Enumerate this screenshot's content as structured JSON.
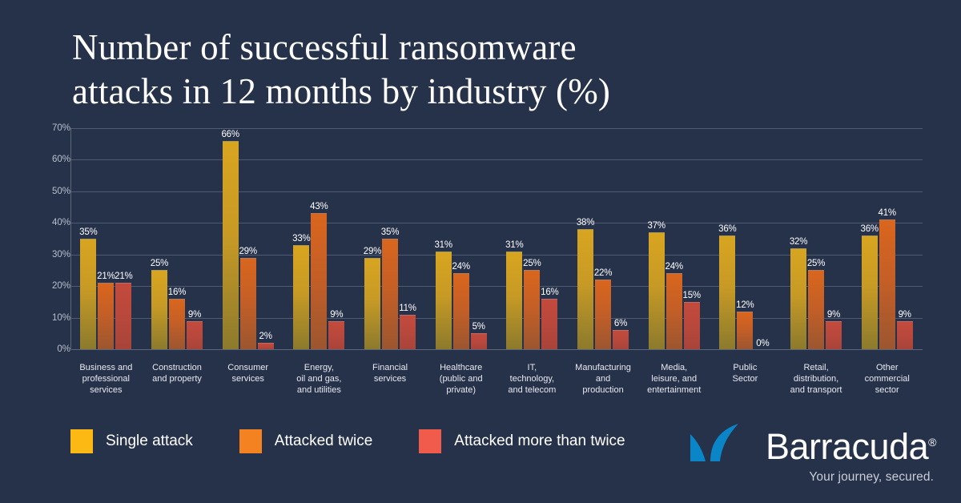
{
  "title": "Number of successful ransomware\nattacks in 12 months by industry (%)",
  "colors": {
    "background": "#26314a",
    "gridline": "#505a70",
    "axis": "#5d6579",
    "series_single": "#d8a520",
    "series_twice": "#d9661e",
    "series_more": "#c24a3c",
    "legend_single": "#fdb913",
    "legend_twice": "#f58220",
    "legend_more": "#f15b4c",
    "logo_blue": "#0a86c8",
    "label_text": "#e8eaf0"
  },
  "legend": {
    "items": [
      {
        "label": "Single attack",
        "color": "#fdb913"
      },
      {
        "label": "Attacked twice",
        "color": "#f58220"
      },
      {
        "label": "Attacked more than twice",
        "color": "#f15b4c"
      }
    ]
  },
  "logo": {
    "wordmark": "Barracuda",
    "registered": "®",
    "tagline": "Your journey, secured.",
    "mark": "barracuda-fin-icon"
  },
  "chart_data": {
    "type": "bar",
    "title": "Number of successful ransomware attacks in 12 months by industry (%)",
    "xlabel": "",
    "ylabel": "",
    "ylim": [
      0,
      70
    ],
    "ytick_values": [
      0,
      10,
      20,
      30,
      40,
      50,
      60,
      70
    ],
    "ytick_labels": [
      "0%",
      "10%",
      "20%",
      "30%",
      "40%",
      "50%",
      "60%",
      "70%"
    ],
    "grid": true,
    "legend_position": "bottom-left",
    "value_suffix": "%",
    "categories": [
      "Business and\nprofessional\nservices",
      "Construction\nand property",
      "Consumer\nservices",
      "Energy,\noil and gas,\nand utilities",
      "Financial\nservices",
      "Healthcare\n(public and\nprivate)",
      "IT,\ntechnology,\nand telecom",
      "Manufacturing\nand\nproduction",
      "Media,\nleisure, and\nentertainment",
      "Public\nSector",
      "Retail,\ndistribution,\nand transport",
      "Other\ncommercial\nsector"
    ],
    "series": [
      {
        "name": "Single attack",
        "color": "#d8a520",
        "values": [
          35,
          25,
          66,
          33,
          29,
          31,
          31,
          38,
          37,
          36,
          32,
          36
        ],
        "labels": [
          "35%",
          "25%",
          "66%",
          "33%",
          "29%",
          "31%",
          "31%",
          "38%",
          "37%",
          "36%",
          "32%",
          "36%"
        ]
      },
      {
        "name": "Attacked twice",
        "color": "#d9661e",
        "values": [
          21,
          16,
          29,
          43,
          35,
          24,
          25,
          22,
          24,
          12,
          25,
          41
        ],
        "labels": [
          "21%",
          "16%",
          "29%",
          "43%",
          "35%",
          "24%",
          "25%",
          "22%",
          "24%",
          "12%",
          "25%",
          "41%"
        ]
      },
      {
        "name": "Attacked more than twice",
        "color": "#c24a3c",
        "values": [
          21,
          9,
          2,
          9,
          11,
          5,
          16,
          6,
          15,
          0,
          9,
          9
        ],
        "labels": [
          "21%",
          "9%",
          "2%",
          "9%",
          "11%",
          "5%",
          "16%",
          "6%",
          "15%",
          "0%",
          "9%",
          "9%"
        ]
      }
    ]
  }
}
